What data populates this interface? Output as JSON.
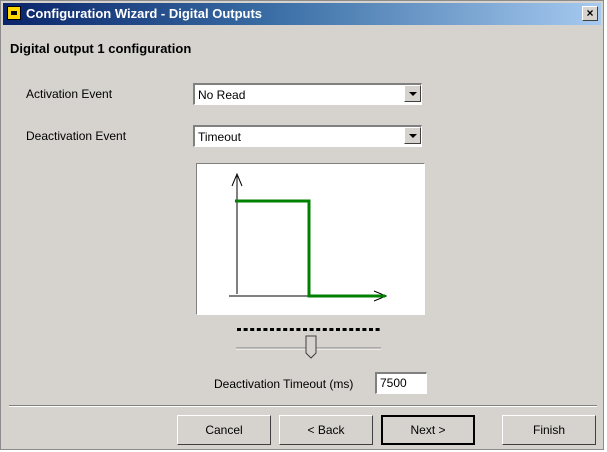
{
  "window": {
    "title": "Configuration Wizard - Digital Outputs",
    "close_label": "×"
  },
  "header": {
    "title": "Digital output 1 configuration"
  },
  "form": {
    "activation_label": "Activation Event",
    "activation_value": "No Read",
    "deactivation_label": "Deactivation Event",
    "deactivation_value": "Timeout",
    "timeout_label": "Deactivation Timeout (ms)",
    "timeout_value": "7500"
  },
  "signal_graph": {
    "signal_color": "#008000",
    "axis_color": "#000000"
  },
  "slider": {
    "value": 7500
  },
  "buttons": {
    "cancel": "Cancel",
    "back": "< Back",
    "next": "Next >",
    "finish": "Finish"
  },
  "colors": {
    "dialog_bg": "#d6d3ce",
    "title_start": "#0a246a",
    "title_end": "#a6caf0"
  }
}
